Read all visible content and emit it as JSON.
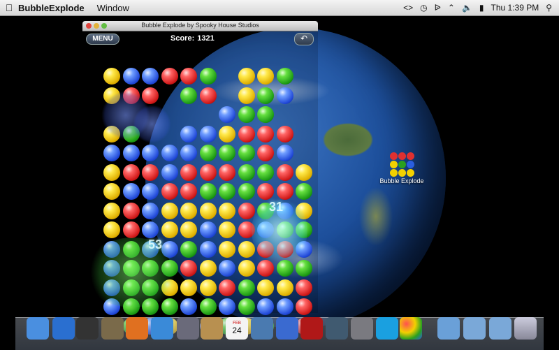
{
  "menubar": {
    "app_name": "BubbleExplode",
    "menus": [
      "Window"
    ],
    "clock": "Thu 1:39 PM"
  },
  "window": {
    "title": "Bubble Explode by Spooky House Studios",
    "menu_label": "MENU",
    "score_label": "Score:",
    "score_value": "1321"
  },
  "popups": [
    "31",
    "53"
  ],
  "desktop_icon": {
    "label": "Bubble Explode"
  },
  "board": {
    "cols": 11,
    "rows": [
      "ybbrrg.yyg.",
      "yrr.gr.ygb.",
      "......bgg..",
      "yg..bbyrrr.",
      "bbbbbgggrb.",
      "yrrbrrrggry",
      "ybbrrgggrrg",
      "yrbyyyyrgby",
      "yrbyybyrbgg",
      "bgbbgbyyrrb",
      "bgggrybyrgg",
      "bggyyyrgyyr",
      "bgggbgbgbbr",
      "bgbyybgygrr"
    ]
  },
  "dock": {
    "items": [
      "finder-icon",
      "app-store-icon",
      "dashboard-icon",
      "mail-stamp-icon",
      "firefox-icon",
      "safari-icon",
      "facetime-icon",
      "address-book-icon",
      "ical-icon",
      "iphoto-icon",
      "itunes-icon",
      "photo-booth-icon",
      "time-machine-icon",
      "system-preferences-icon",
      "skype-icon",
      "bubble-explode-icon",
      "applications-folder-icon",
      "documents-folder-icon",
      "downloads-folder-icon",
      "trash-icon"
    ],
    "ical_day": "24",
    "ical_month": "FEB"
  }
}
